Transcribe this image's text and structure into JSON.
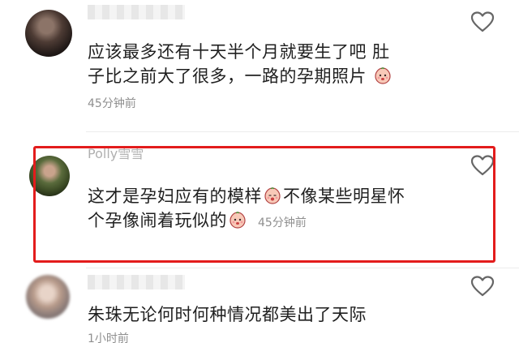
{
  "comments": [
    {
      "username": "",
      "text_line1": "应该最多还有十天半个月就要生了吧 肚",
      "text_line2": "子比之前大了很多，一路的孕期照片",
      "time": "45分钟前",
      "emoji": "peach-face-emoji",
      "liked": false,
      "highlighted": false
    },
    {
      "username": "Polly雪雪",
      "text_line1": "这才是孕妇应有的模样",
      "text_line1_after": "不像某些明星怀",
      "text_line2": "个孕像闹着玩似的",
      "time": "45分钟前",
      "emoji": "peach-face-emoji",
      "liked": false,
      "highlighted": true
    },
    {
      "username": "",
      "text_line1": "朱珠无论何时何种情况都美出了天际",
      "time": "1小时前",
      "liked": false,
      "highlighted": false
    }
  ],
  "icons": {
    "like": "heart-outline-icon",
    "emoji": "peach-face-emoji"
  },
  "colors": {
    "highlight_border": "#e31c1c",
    "text": "#1f1f1f",
    "meta": "#8f8f8f",
    "heart_outline": "#666666"
  }
}
